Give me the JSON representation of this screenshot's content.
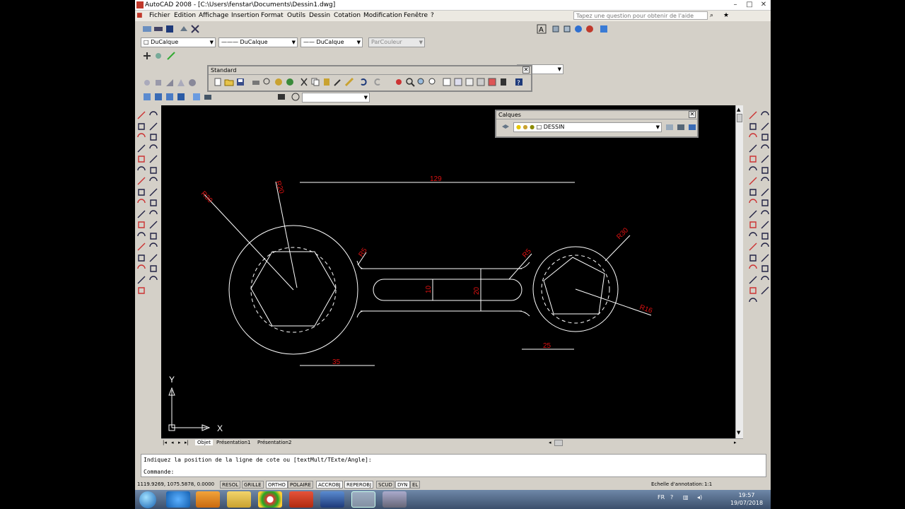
{
  "titlebar": {
    "title": "AutoCAD 2008 - [C:\\Users\\fenstar\\Documents\\Dessin1.dwg]"
  },
  "menu": {
    "items": [
      "Fichier",
      "Edition",
      "Affichage",
      "Insertion",
      "Format",
      "Outils",
      "Dessin",
      "Cotation",
      "Modification",
      "Fenêtre",
      "?"
    ],
    "search_placeholder": "Tapez une question pour obtenir de l'aide"
  },
  "properties": {
    "color": "DuCalque",
    "linetype": "DuCalque",
    "lineweight": "DuCalque",
    "plotstyle": "ParCouleur"
  },
  "standard_panel": {
    "title": "Standard"
  },
  "layers_panel": {
    "title": "Calques",
    "current_layer": "DESSIN"
  },
  "drawing": {
    "dimensions": {
      "d129": "129",
      "r30_left": "R30",
      "r20": "R20",
      "r5_left": "R5",
      "r5_right": "R5",
      "r30_right": "R30",
      "r16": "R16",
      "d10": "10",
      "d20": "20",
      "d35": "35",
      "d25": "25"
    },
    "ucs": {
      "y": "Y",
      "x": "X"
    }
  },
  "tabs": [
    "Objet",
    "Présentation1",
    "Présentation2"
  ],
  "command": {
    "prompt_line": "Indiquez la position de la ligne de cote ou [textMult/TExte/Angle]:",
    "input_label": "Commande:"
  },
  "status": {
    "coords": "1119.9269, 1075.5878, 0.0000",
    "toggles": [
      "RESOL",
      "GRILLE",
      "ORTHO",
      "POLAIRE",
      "ACCROBJ",
      "REPEROBJ",
      "SCUD",
      "DYN",
      "EL"
    ],
    "annotation_label": "Echelle d'annotation:",
    "annotation_scale": "1:1"
  },
  "taskbar": {
    "lang": "FR",
    "time": "19:57",
    "date": "19/07/2018"
  },
  "colors": {
    "dimension": "#dd1111",
    "geometry": "#ffffff",
    "canvas": "#000000"
  }
}
